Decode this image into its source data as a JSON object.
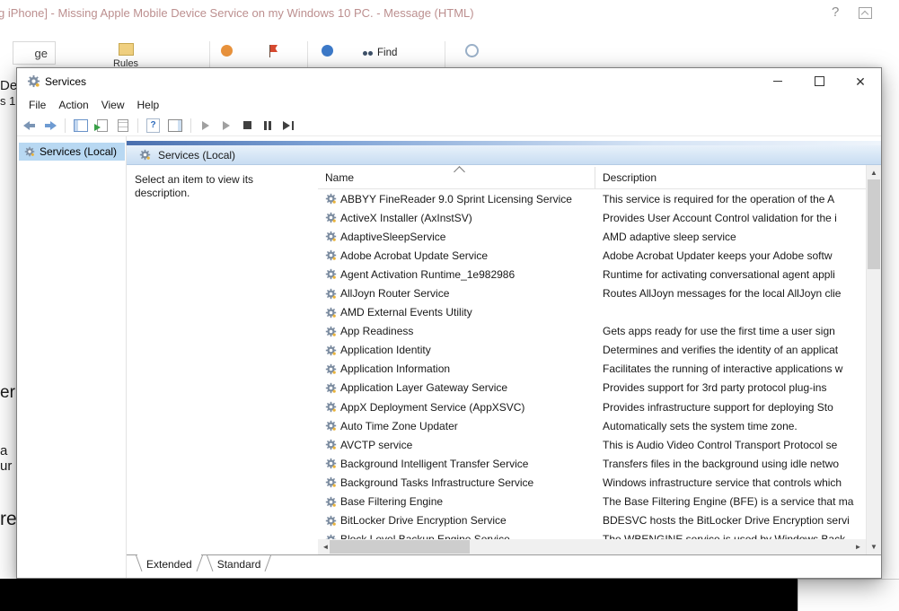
{
  "background_window": {
    "title_bar": {
      "title": "g iPhone] - Missing Apple Mobile Device Service on my Windows 10 PC. - Message (HTML)",
      "help_icon": "?"
    },
    "ribbon": {
      "tab_fragment": "ge",
      "rules_label": "Rules",
      "find_label": "Find"
    },
    "message_fragments": [
      "De",
      "s 1",
      "er",
      "a",
      "ur",
      "re"
    ]
  },
  "services_window": {
    "title": "Services",
    "menu": [
      "File",
      "Action",
      "View",
      "Help"
    ],
    "toolbar": {
      "help_icon": "?"
    },
    "tree": {
      "selected_item": "Services (Local)"
    },
    "content_header": "Services (Local)",
    "description_placeholder": "Select an item to view its description.",
    "list": {
      "columns": [
        "Name",
        "Description"
      ],
      "rows": [
        {
          "name": "ABBYY FineReader 9.0 Sprint Licensing Service",
          "description": "This service is required for the operation of the A"
        },
        {
          "name": "ActiveX Installer (AxInstSV)",
          "description": "Provides User Account Control validation for the i"
        },
        {
          "name": "AdaptiveSleepService",
          "description": "AMD adaptive sleep service"
        },
        {
          "name": "Adobe Acrobat Update Service",
          "description": "Adobe Acrobat Updater keeps your Adobe softw"
        },
        {
          "name": "Agent Activation Runtime_1e982986",
          "description": "Runtime for activating conversational agent appli"
        },
        {
          "name": "AllJoyn Router Service",
          "description": "Routes AllJoyn messages for the local AllJoyn clie"
        },
        {
          "name": "AMD External Events Utility",
          "description": ""
        },
        {
          "name": "App Readiness",
          "description": "Gets apps ready for use the first time a user sign"
        },
        {
          "name": "Application Identity",
          "description": "Determines and verifies the identity of an applicat"
        },
        {
          "name": "Application Information",
          "description": "Facilitates the running of interactive applications w"
        },
        {
          "name": "Application Layer Gateway Service",
          "description": "Provides support for 3rd party protocol plug-ins"
        },
        {
          "name": "AppX Deployment Service (AppXSVC)",
          "description": "Provides infrastructure support for deploying Sto"
        },
        {
          "name": "Auto Time Zone Updater",
          "description": "Automatically sets the system time zone."
        },
        {
          "name": "AVCTP service",
          "description": "This is Audio Video Control Transport Protocol se"
        },
        {
          "name": "Background Intelligent Transfer Service",
          "description": "Transfers files in the background using idle netwo"
        },
        {
          "name": "Background Tasks Infrastructure Service",
          "description": "Windows infrastructure service that controls which"
        },
        {
          "name": "Base Filtering Engine",
          "description": "The Base Filtering Engine (BFE) is a service that ma"
        },
        {
          "name": "BitLocker Drive Encryption Service",
          "description": "BDESVC hosts the BitLocker Drive Encryption servi"
        },
        {
          "name": "Block Level Backup Engine Service",
          "description": "The WBENGINE service is used by Windows Back"
        }
      ]
    },
    "tabs": [
      "Extended",
      "Standard"
    ]
  }
}
